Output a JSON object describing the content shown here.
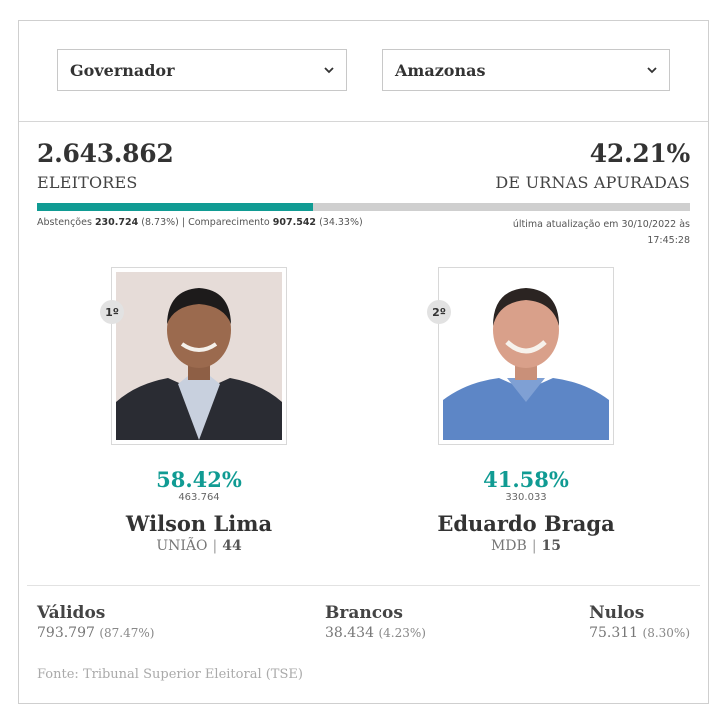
{
  "filters": {
    "office": "Governador",
    "state": "Amazonas"
  },
  "summary": {
    "electors_value": "2.643.862",
    "electors_label": "ELEITORES",
    "counted_value": "42.21%",
    "counted_label": "DE URNAS APURADAS",
    "counted_fraction": 0.4221,
    "abstentions_label": "Abstenções",
    "abstentions_value": "230.724",
    "abstentions_pct": "(8.73%)",
    "separator": "|",
    "turnout_label": "Comparecimento",
    "turnout_value": "907.542",
    "turnout_pct": "(34.33%)",
    "updated": "última atualização em 30/10/2022 às 17:45:28"
  },
  "candidates": [
    {
      "rank": "1º",
      "percent": "58.42%",
      "votes": "463.764",
      "name": "Wilson Lima",
      "party": "UNIÃO",
      "separator": "|",
      "number": "44"
    },
    {
      "rank": "2º",
      "percent": "41.58%",
      "votes": "330.033",
      "name": "Eduardo Braga",
      "party": "MDB",
      "separator": "|",
      "number": "15"
    }
  ],
  "totals": {
    "valid_label": "Válidos",
    "valid_value": "793.797",
    "valid_pct": "(87.47%)",
    "blank_label": "Brancos",
    "blank_value": "38.434",
    "blank_pct": "(4.23%)",
    "null_label": "Nulos",
    "null_value": "75.311",
    "null_pct": "(8.30%)"
  },
  "source": "Fonte: Tribunal Superior Eleitoral (TSE)",
  "colors": {
    "accent": "#109b93",
    "progress_track": "#cfcfcf"
  }
}
